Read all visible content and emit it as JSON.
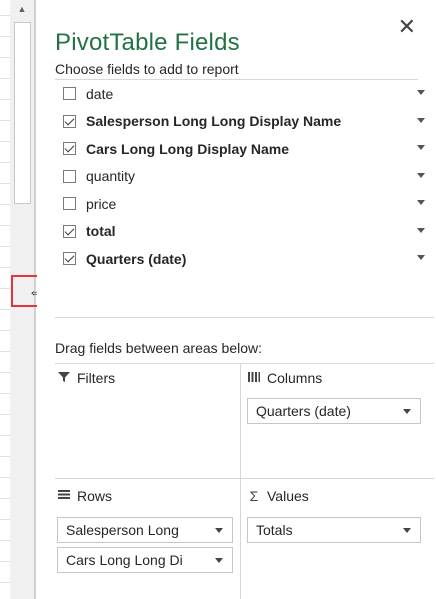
{
  "pane": {
    "title": "PivotTable Fields",
    "subtitle": "Choose fields to add to report",
    "close_icon": "close-icon"
  },
  "fields": [
    {
      "label": "date",
      "checked": false
    },
    {
      "label": "Salesperson Long Long Display Name",
      "checked": true
    },
    {
      "label": "Cars Long Long Display Name",
      "checked": true
    },
    {
      "label": "quantity",
      "checked": false
    },
    {
      "label": "price",
      "checked": false
    },
    {
      "label": "total",
      "checked": true
    },
    {
      "label": "Quarters (date)",
      "checked": true
    }
  ],
  "areas": {
    "instruction": "Drag fields between areas below:",
    "filters": {
      "label": "Filters",
      "icon": "filter-icon",
      "items": []
    },
    "columns": {
      "label": "Columns",
      "icon": "columns-icon",
      "items": [
        "Quarters (date)"
      ]
    },
    "rows": {
      "label": "Rows",
      "icon": "rows-icon",
      "items": [
        "Salesperson Long",
        "Cars Long Long Di"
      ]
    },
    "values": {
      "label": "Values",
      "icon": "sigma-icon",
      "items": [
        "Totals"
      ]
    }
  },
  "colors": {
    "title_green": "#217346",
    "highlight_red": "#e0373f"
  }
}
